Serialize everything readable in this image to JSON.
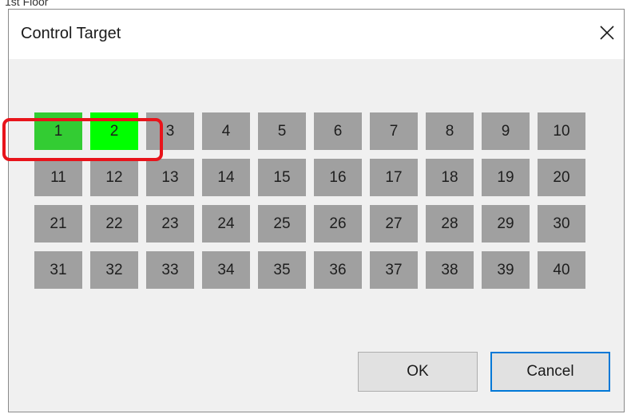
{
  "background": {
    "partial_text": "1st Floor"
  },
  "dialog": {
    "title": "Control Target",
    "close_icon": "close-icon",
    "buttons": {
      "ok": "OK",
      "cancel": "Cancel"
    }
  },
  "grid": {
    "cells": [
      "1",
      "2",
      "3",
      "4",
      "5",
      "6",
      "7",
      "8",
      "9",
      "10",
      "11",
      "12",
      "13",
      "14",
      "15",
      "16",
      "17",
      "18",
      "19",
      "20",
      "21",
      "22",
      "23",
      "24",
      "25",
      "26",
      "27",
      "28",
      "29",
      "30",
      "31",
      "32",
      "33",
      "34",
      "35",
      "36",
      "37",
      "38",
      "39",
      "40"
    ],
    "selected": [
      "1",
      "2"
    ]
  },
  "colors": {
    "cell_default": "#a0a0a0",
    "cell_selected_1": "#33cc33",
    "cell_selected_2": "#00ff00",
    "highlight_outline": "#e8141b",
    "default_button_border": "#0078d7"
  }
}
